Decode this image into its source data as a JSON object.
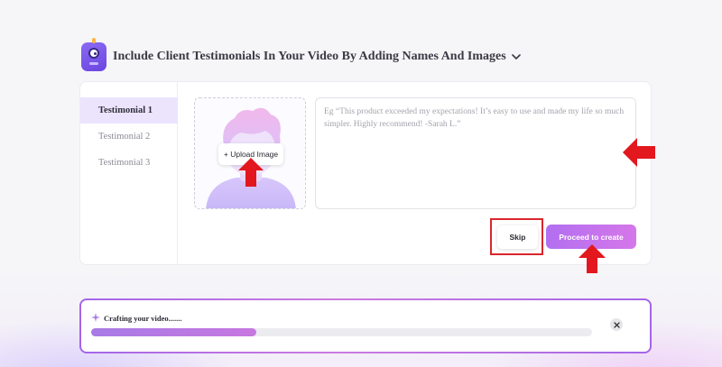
{
  "header": {
    "title": "Include Client Testimonials In Your Video By Adding Names And Images",
    "logo_icon": "mascot-icon",
    "dropdown_icon": "chevron-down-icon"
  },
  "sidebar": {
    "items": [
      {
        "label": "Testimonial 1",
        "active": true
      },
      {
        "label": "Testimonial 2",
        "active": false
      },
      {
        "label": "Testimonial 3",
        "active": false
      }
    ]
  },
  "upload": {
    "button_label": "+ Upload Image"
  },
  "testimonial_input": {
    "placeholder": "Eg “This product exceeded my expectations! It’s easy to use and made my life so much simpler. Highly recommend! -Sarah L.”",
    "value": ""
  },
  "actions": {
    "skip_label": "Skip",
    "proceed_label": "Proceed to create"
  },
  "progress": {
    "status_text": "Crafting your video.......",
    "percent": 33,
    "close_icon": "close-icon"
  },
  "colors": {
    "accent": "#b26ff0",
    "annotation_red": "#e3171e",
    "active_tab_bg": "#ece4fd"
  }
}
